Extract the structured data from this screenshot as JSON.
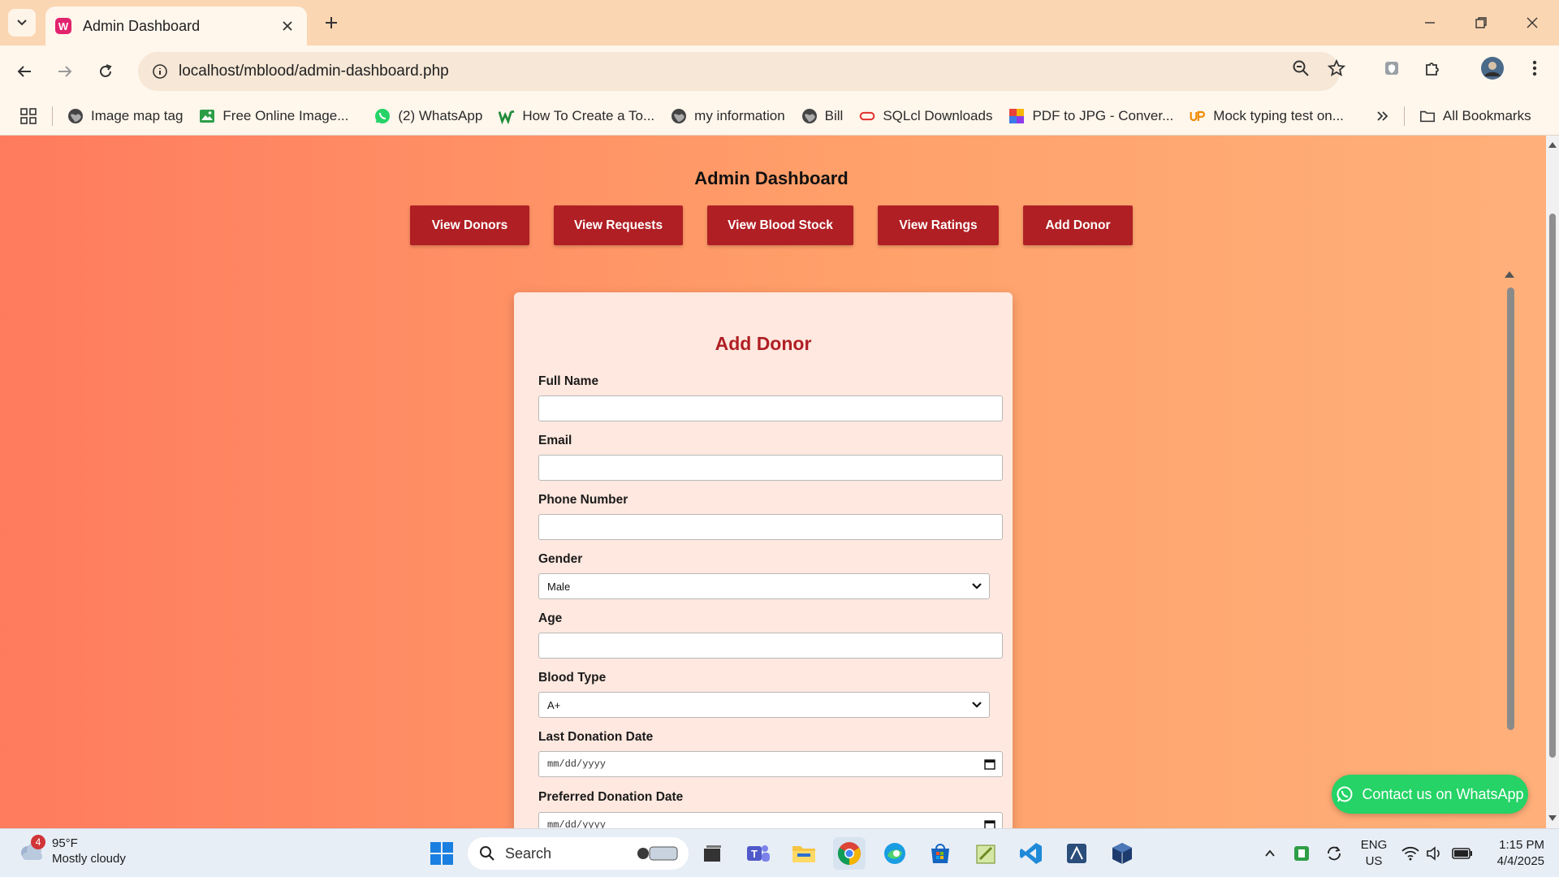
{
  "browser": {
    "tab_title": "Admin Dashboard",
    "url": "localhost/mblood/admin-dashboard.php"
  },
  "bookmarks": [
    {
      "label": "Image map tag",
      "icon": "globe-icon"
    },
    {
      "label": "Free Online Image...",
      "icon": "image-icon"
    },
    {
      "label": "(2) WhatsApp",
      "icon": "whatsapp-icon"
    },
    {
      "label": "How To Create a To...",
      "icon": "w-logo-icon"
    },
    {
      "label": "my information",
      "icon": "globe-icon"
    },
    {
      "label": "Bill",
      "icon": "globe-icon"
    },
    {
      "label": "SQLcl Downloads",
      "icon": "oracle-icon"
    },
    {
      "label": "PDF to JPG - Conver...",
      "icon": "pdf-tool-icon"
    },
    {
      "label": "Mock typing test on...",
      "icon": "up-logo-icon"
    }
  ],
  "all_bookmarks": "All Bookmarks",
  "page": {
    "title": "Admin Dashboard",
    "nav": [
      {
        "label": "View Donors"
      },
      {
        "label": "View Requests"
      },
      {
        "label": "View Blood Stock"
      },
      {
        "label": "View Ratings"
      },
      {
        "label": "Add Donor"
      }
    ],
    "form": {
      "title": "Add Donor",
      "full_name_label": "Full Name",
      "email_label": "Email",
      "phone_label": "Phone Number",
      "gender_label": "Gender",
      "gender_value": "Male",
      "age_label": "Age",
      "blood_type_label": "Blood Type",
      "blood_type_value": "A+",
      "last_donation_label": "Last Donation Date",
      "last_donation_value": "mm/dd/yyyy",
      "preferred_donation_label": "Preferred Donation Date",
      "preferred_donation_value": "mm/dd/yyyy"
    },
    "whatsapp_button": "Contact us on WhatsApp"
  },
  "taskbar": {
    "weather_badge": "4",
    "temperature": "95°F",
    "condition": "Mostly cloudy",
    "search_label": "Search",
    "lang_line1": "ENG",
    "lang_line2": "US",
    "time": "1:15 PM",
    "date": "4/4/2025"
  },
  "colors": {
    "accent_button": "#b01f24",
    "whatsapp_green": "#25d366"
  }
}
